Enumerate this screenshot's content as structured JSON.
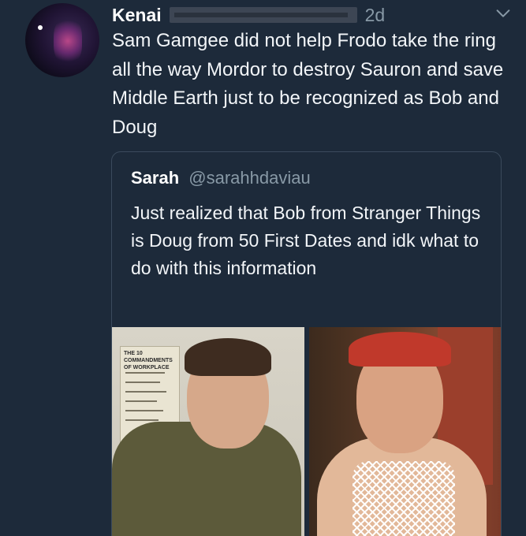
{
  "tweet": {
    "author_name": "Kenai",
    "timestamp": "2d",
    "text": "Sam Gamgee did not help Frodo take the ring all the way Mordor to destroy Sauron and save Middle Earth just to be recognized as Bob and Doug"
  },
  "quoted_tweet": {
    "author_name": "Sarah",
    "author_handle": "@sarahhdaviau",
    "text": "Just realized that Bob from Stranger Things is Doug from 50 First Dates and idk what to do with this information",
    "poster_text": "THE 10 COMMANDMENTS OF WORKPLACE"
  },
  "icons": {
    "menu": "chevron-down-icon"
  }
}
